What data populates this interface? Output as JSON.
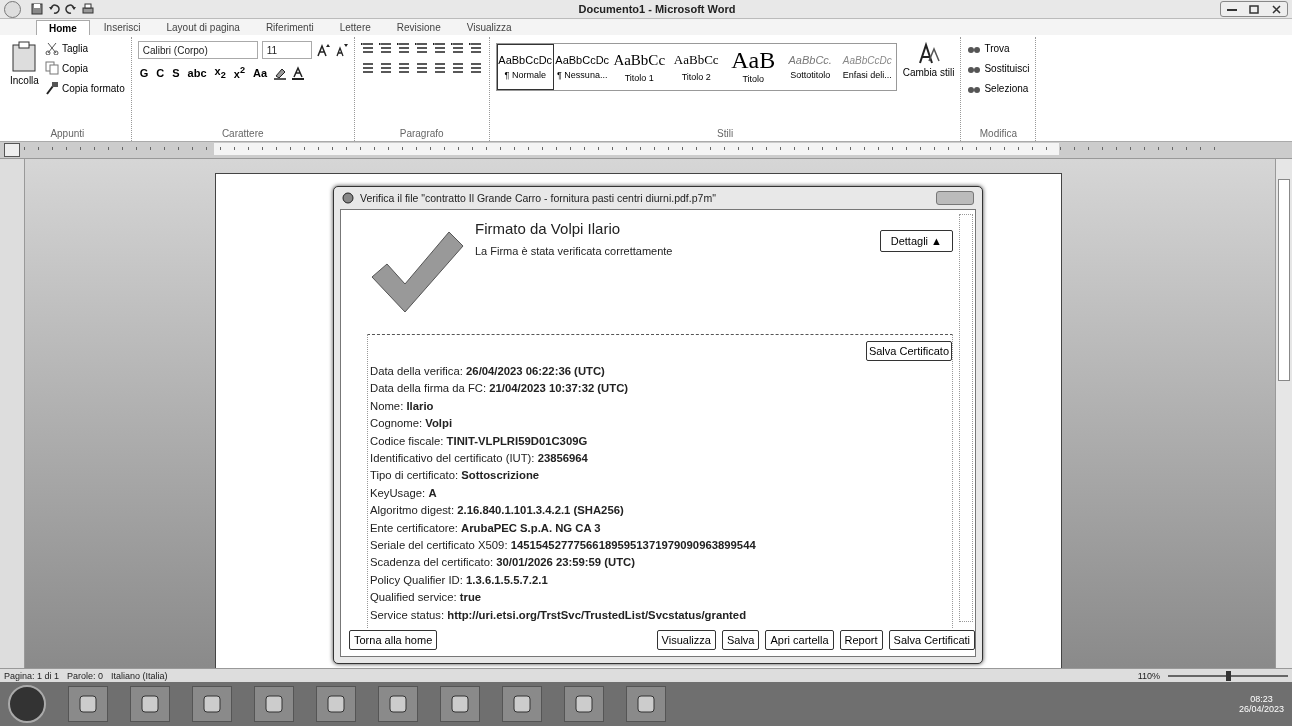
{
  "window": {
    "title": "Documento1 - Microsoft Word"
  },
  "tabs": [
    {
      "label": "Home",
      "selected": true
    },
    {
      "label": "Inserisci",
      "selected": false
    },
    {
      "label": "Layout di pagina",
      "selected": false
    },
    {
      "label": "Riferimenti",
      "selected": false
    },
    {
      "label": "Lettere",
      "selected": false
    },
    {
      "label": "Revisione",
      "selected": false
    },
    {
      "label": "Visualizza",
      "selected": false
    }
  ],
  "ribbon": {
    "clipboard": {
      "paste": "Incolla",
      "items": [
        "Taglia",
        "Copia",
        "Copia formato"
      ],
      "label": "Appunti"
    },
    "font": {
      "family": "Calibri (Corpo)",
      "size": "11",
      "format_buttons": [
        "G",
        "C",
        "S",
        "abc",
        "x$_{2}$",
        "x$^{2}$",
        "Aa"
      ],
      "label": "Carattere"
    },
    "paragraph": {
      "label": "Paragrafo"
    },
    "styles": {
      "items": [
        {
          "preview": "AaBbCcDc",
          "label": "¶ Normale",
          "kind": "normal",
          "selected": true
        },
        {
          "preview": "AaBbCcDc",
          "label": "¶ Nessuna...",
          "kind": "normal",
          "selected": false
        },
        {
          "preview": "AaBbCc",
          "label": "Titolo 1",
          "kind": "heading1",
          "selected": false
        },
        {
          "preview": "AaBbCc",
          "label": "Titolo 2",
          "kind": "heading2",
          "selected": false
        },
        {
          "preview": "AaB",
          "label": "Titolo",
          "kind": "title",
          "selected": false
        },
        {
          "preview": "AaBbCc.",
          "label": "Sottotitolo",
          "kind": "subtitle",
          "selected": false
        },
        {
          "preview": "AaBbCcDc",
          "label": "Enfasi deli...",
          "kind": "emphasis",
          "selected": false
        }
      ],
      "change": "Cambia stili",
      "label": "Stili"
    },
    "editing": {
      "items": [
        "Trova",
        "Sostituisci",
        "Seleziona"
      ],
      "label": "Modifica"
    }
  },
  "dialog": {
    "title": "Verifica il file \"contratto Il Grande Carro - fornitura pasti centri diurni.pdf.p7m\"",
    "heading": "Firmato da Volpi Ilario",
    "message": "La Firma è stata verificata correttamente",
    "details_button": "Dettagli ▲",
    "save_certificate": "Salva Certificato",
    "details": [
      {
        "label": "Data della verifica:",
        "value": "26/04/2023 06:22:36 (UTC)"
      },
      {
        "label": "Data della firma da FC:",
        "value": "21/04/2023 10:37:32 (UTC)"
      },
      {
        "label": "Nome:",
        "value": "Ilario"
      },
      {
        "label": "Cognome:",
        "value": "Volpi"
      },
      {
        "label": "Codice fiscale:",
        "value": "TINIT-VLPLRI59D01C309G"
      },
      {
        "label": "Identificativo del certificato (IUT):",
        "value": "23856964"
      },
      {
        "label": "Tipo di certificato:",
        "value": "Sottoscrizione"
      },
      {
        "label": "KeyUsage:",
        "value": "A"
      },
      {
        "label": "Algoritmo digest:",
        "value": "2.16.840.1.101.3.4.2.1 (SHA256)"
      },
      {
        "label": "Ente certificatore:",
        "value": "ArubaPEC S.p.A. NG CA 3"
      },
      {
        "label": "Seriale del certificato X509:",
        "value": "145154527775661895951371979090963899544"
      },
      {
        "label": "Scadenza del certificato:",
        "value": "30/01/2026 23:59:59 (UTC)"
      },
      {
        "label": "Policy Qualifier ID:",
        "value": "1.3.6.1.5.5.7.2.1"
      },
      {
        "label": "Qualified service:",
        "value": "true"
      },
      {
        "label": "Service status:",
        "value": "http://uri.etsi.org/TrstSvc/TrustedList/Svcstatus/granted"
      }
    ],
    "home_button": "Torna alla home",
    "buttons": [
      "Visualizza",
      "Salva",
      "Apri cartella",
      "Report",
      "Salva Certificati"
    ]
  },
  "status_bar": {
    "page": "Pagina: 1 di 1",
    "words": "Parole: 0",
    "language": "Italiano (Italia)",
    "zoom": "110%",
    "zoom_slider": {
      "level": 0.5
    }
  },
  "taskbar": {
    "time": "08:23",
    "date": "26/04/2023"
  }
}
